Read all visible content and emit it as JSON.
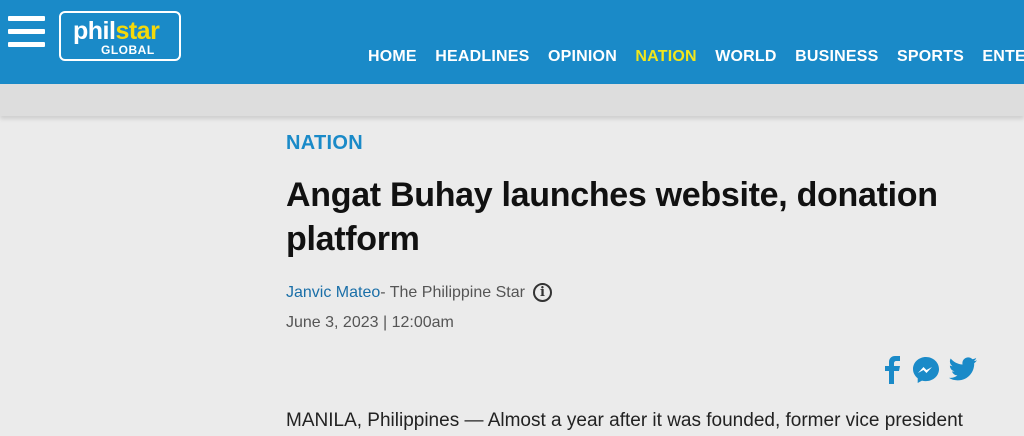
{
  "header": {
    "logo_phil": "phil",
    "logo_star": "star",
    "logo_sub": "GLOBAL",
    "nav": [
      "HOME",
      "HEADLINES",
      "OPINION",
      "NATION",
      "WORLD",
      "BUSINESS",
      "SPORTS",
      "ENTERTAINMENT"
    ],
    "active_nav": "NATION",
    "bg_color": "#1a8ac8",
    "active_color": "#f2e61a"
  },
  "article": {
    "section": "NATION",
    "title": "Angat Buhay launches website, donation platform",
    "author": "Janvic Mateo",
    "source": " - The Philippine Star",
    "date": "June 3, 2023 | 12:00am",
    "lede": "MANILA, Philippines — Almost a year after it was founded, former vice president"
  },
  "share": {
    "icons": [
      "facebook-icon",
      "messenger-icon",
      "twitter-icon"
    ],
    "color": "#1a8ac8"
  }
}
